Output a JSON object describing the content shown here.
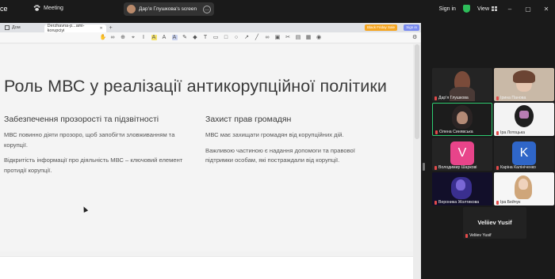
{
  "topbar": {
    "app_title": "ce",
    "meeting_label": "Meeting",
    "share_label": "Дарʼя Глушкова's screen",
    "sign_in": "Sign in",
    "view": "View"
  },
  "browser": {
    "home_tab": "Дом",
    "active_tab": "Derzhavna-p...ami-korupciyi",
    "promo": "Black Friday Sale",
    "sign_in_button": "Sign in"
  },
  "slide": {
    "title": "Роль МВС у реалізації антикорупційної політики",
    "left_heading": "Забезпечення прозорості та підзвітності",
    "left_p1": "МВС повинно діяти прозоро, щоб запобігти зловживанням та корупції.",
    "left_p2": "Відкритість інформації про діяльність МВС – ключовий елемент протидії корупції.",
    "right_heading": "Захист прав громадян",
    "right_p1": "МВС має захищати громадян від корупційних дій.",
    "right_p2": "Важливою частиною є надання допомоги та правової підтримки особам, які постраждали від корупції."
  },
  "participants": [
    {
      "name": "Дарʼя Глушкова"
    },
    {
      "name": "Ірина Панова"
    },
    {
      "name": "Олена Синявська"
    },
    {
      "name": "Іра Лотоцька"
    },
    {
      "name": "Володимир Шаркові",
      "letter": "V",
      "color": "#e8448a"
    },
    {
      "name": "Каріна Калініченко",
      "letter": "K",
      "color": "#2f66c8"
    },
    {
      "name": "Вероника Жолтикова"
    },
    {
      "name": "Іра Бейчук"
    }
  ],
  "solo_participant": {
    "display": "Veliiev Yusif",
    "name": "Veliiev Yusif"
  }
}
